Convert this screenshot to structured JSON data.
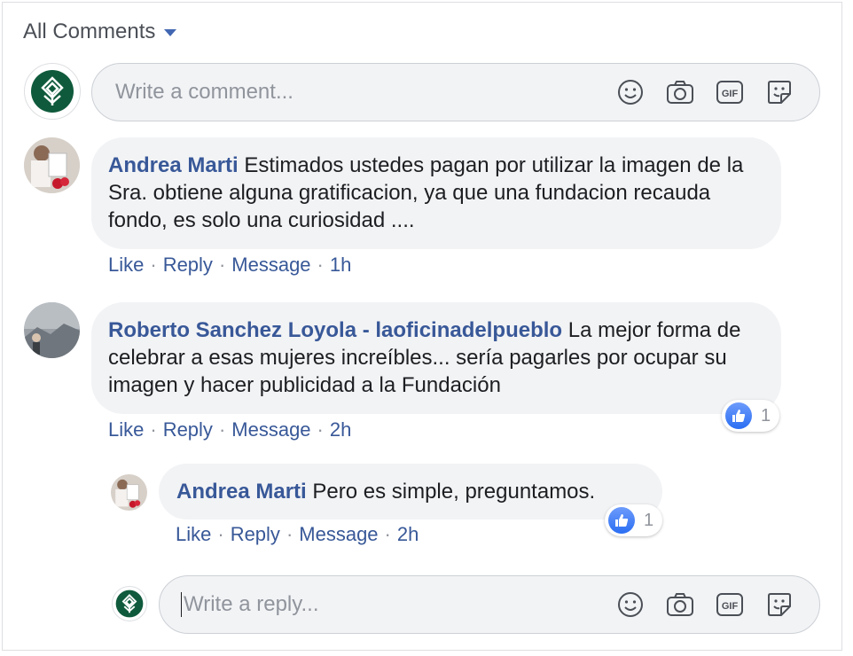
{
  "header": {
    "sort_label": "All Comments"
  },
  "composer": {
    "placeholder": "Write a comment..."
  },
  "comments": [
    {
      "author": "Andrea Marti",
      "text": "Estimados ustedes pagan por utilizar la imagen de la Sra. obtiene alguna gratificacion, ya que una fundacion recauda fondo, es solo una curiosidad ....",
      "actions": {
        "like": "Like",
        "reply": "Reply",
        "message": "Message",
        "time": "1h"
      }
    },
    {
      "author": "Roberto Sanchez Loyola - laoficinadelpueblo",
      "text": "La mejor forma de celebrar a esas mujeres increíbles... sería pagarles por ocupar su imagen y hacer publicidad a la Fundación",
      "actions": {
        "like": "Like",
        "reply": "Reply",
        "message": "Message",
        "time": "2h"
      },
      "reactions": {
        "count": "1"
      }
    }
  ],
  "reply": {
    "author": "Andrea Marti",
    "text": "Pero es simple, preguntamos.",
    "actions": {
      "like": "Like",
      "reply": "Reply",
      "message": "Message",
      "time": "2h"
    },
    "reactions": {
      "count": "1"
    }
  },
  "reply_composer": {
    "placeholder": "Write a reply..."
  },
  "icons": {
    "emoji": "emoji-icon",
    "camera": "camera-icon",
    "gif": "gif-icon",
    "sticker": "sticker-icon",
    "like": "thumbs-up-icon"
  },
  "colors": {
    "link": "#385898",
    "bubble": "#f2f3f5",
    "brand_green": "#0f5a3c",
    "like_blue": "#2a6ef3"
  }
}
